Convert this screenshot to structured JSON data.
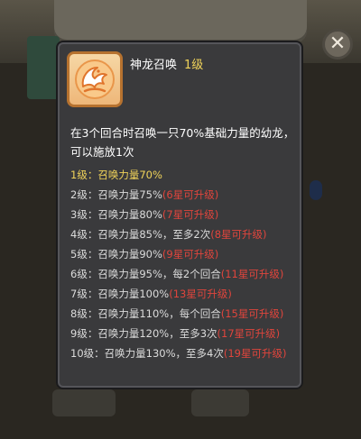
{
  "close_button": {
    "icon": "close-icon",
    "symbol": "✕"
  },
  "skill": {
    "name": "神龙召唤",
    "level": "1级",
    "icon": "dragon-summon-icon",
    "description": "在3个回合时召唤一只70%基础力量的幼龙，可以施放1次"
  },
  "levels": [
    {
      "text": "1级：召唤力量70%",
      "req": "",
      "active": true
    },
    {
      "text": "2级：召唤力量75%",
      "req": "(6星可升级)",
      "active": false
    },
    {
      "text": "3级：召唤力量80%",
      "req": "(7星可升级)",
      "active": false
    },
    {
      "text": "4级：召唤力量85%，至多2次",
      "req": "(8星可升级)",
      "active": false
    },
    {
      "text": "5级：召唤力量90%",
      "req": "(9星可升级)",
      "active": false
    },
    {
      "text": "6级：召唤力量95%，每2个回合",
      "req": "(11星可升级)",
      "active": false
    },
    {
      "text": "7级：召唤力量100%",
      "req": "(13星可升级)",
      "active": false
    },
    {
      "text": "8级：召唤力量110%，每个回合",
      "req": "(15星可升级)",
      "active": false
    },
    {
      "text": "9级：召唤力量120%，至多3次",
      "req": "(17星可升级)",
      "active": false
    },
    {
      "text": "10级：召唤力量130%，至多4次",
      "req": "(19星可升级)",
      "active": false
    }
  ],
  "colors": {
    "panel_bg": "#3a3a3c",
    "highlight": "#f1d45a",
    "requirement": "#e0453c",
    "icon_bg": "#f6d7a5",
    "icon_border": "#b6722f"
  }
}
